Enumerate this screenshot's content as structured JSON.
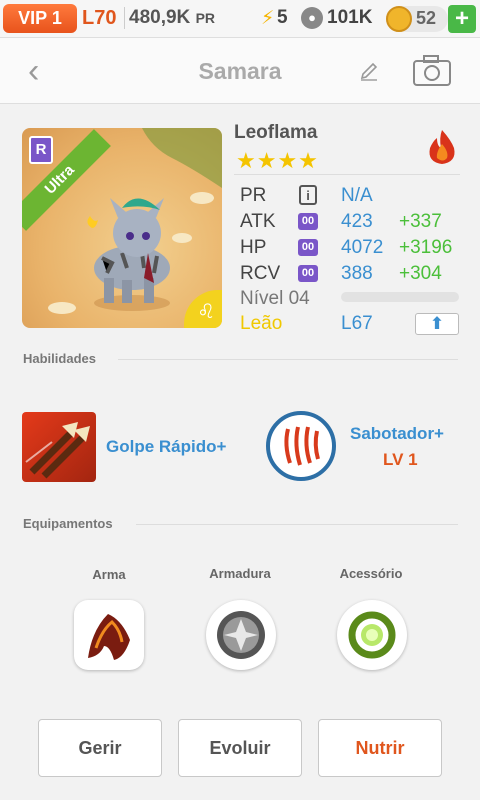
{
  "topbar": {
    "vip": "VIP 1",
    "level": "L70",
    "pr_value": "480,9K",
    "pr_unit": "PR",
    "energy": "5",
    "food": "101K",
    "coins": "52",
    "plus": "+"
  },
  "header": {
    "title": "Samara"
  },
  "pet": {
    "name": "Leoflama",
    "stars": "★★★★",
    "rarity": "Ultra",
    "rank_badge": "R",
    "zodiac_symbol": "♌",
    "element_icon": "fire-icon"
  },
  "stats": {
    "pr_label": "PR",
    "pr_value": "N/A",
    "atk_label": "ATK",
    "atk_value": "423",
    "atk_bonus": "+337",
    "hp_label": "HP",
    "hp_value": "4072",
    "hp_bonus": "+3196",
    "rcv_label": "RCV",
    "rcv_value": "388",
    "rcv_bonus": "+304",
    "badge_text": "00",
    "level_label": "Nível 04",
    "xp_fraction": 0.0,
    "sign": "Leão",
    "sign_level": "L67"
  },
  "skills": {
    "section_title": "Habilidades",
    "skill1_name": "Golpe Rápido+",
    "skill2_name": "Sabotador+",
    "skill2_level": "LV 1"
  },
  "equipment": {
    "section_title": "Equipamentos",
    "weapon": "Arma",
    "armor": "Armadura",
    "accessory": "Acessório"
  },
  "actions": {
    "manage": "Gerir",
    "evolve": "Evoluir",
    "feed": "Nutrir"
  },
  "colors": {
    "accent_orange": "#e0561d",
    "stat_blue": "#3a8fd0",
    "bonus_green": "#4bbf3a",
    "leo_yellow": "#f0c800"
  }
}
